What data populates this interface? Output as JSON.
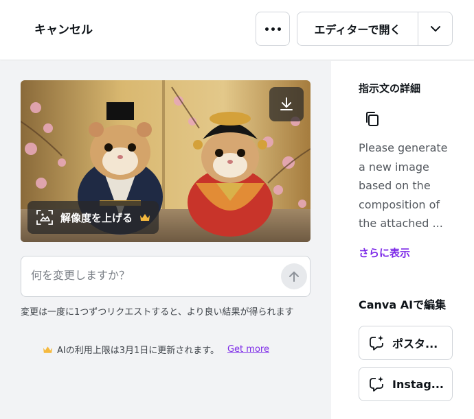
{
  "header": {
    "cancel_label": "キャンセル",
    "more_icon": "more-horizontal-icon",
    "open_editor_label": "エディターで開く",
    "dropdown_icon": "chevron-down-icon"
  },
  "image": {
    "upscale_label": "解像度を上げる",
    "download_icon": "download-icon",
    "upscale_icon": "image-upscale-icon",
    "premium_icon": "crown-icon"
  },
  "prompt": {
    "placeholder": "何を変更しますか？",
    "send_icon": "arrow-up-icon"
  },
  "hint_text": "変更は一度に1つずつリクエストすると、より良い結果が得られます",
  "limit": {
    "text": "AIの利用上限は3月1日に更新されます。",
    "link": "Get more",
    "icon": "crown-icon"
  },
  "sidebar": {
    "details_title": "指示文の詳細",
    "copy_icon": "copy-icon",
    "prompt_text": "Please generate a new image based on the composition of the attached ...",
    "show_more": "さらに表示",
    "edit_title": "Canva AIで編集",
    "edit_buttons": [
      {
        "label": "ポスタ...",
        "icon": "ai-sparkle-chat-icon"
      },
      {
        "label": "Instag...",
        "icon": "ai-sparkle-chat-icon"
      }
    ]
  },
  "colors": {
    "accent": "#7d2ae8",
    "panel_bg": "#f2f3f5",
    "crown": "#f5b93e"
  }
}
